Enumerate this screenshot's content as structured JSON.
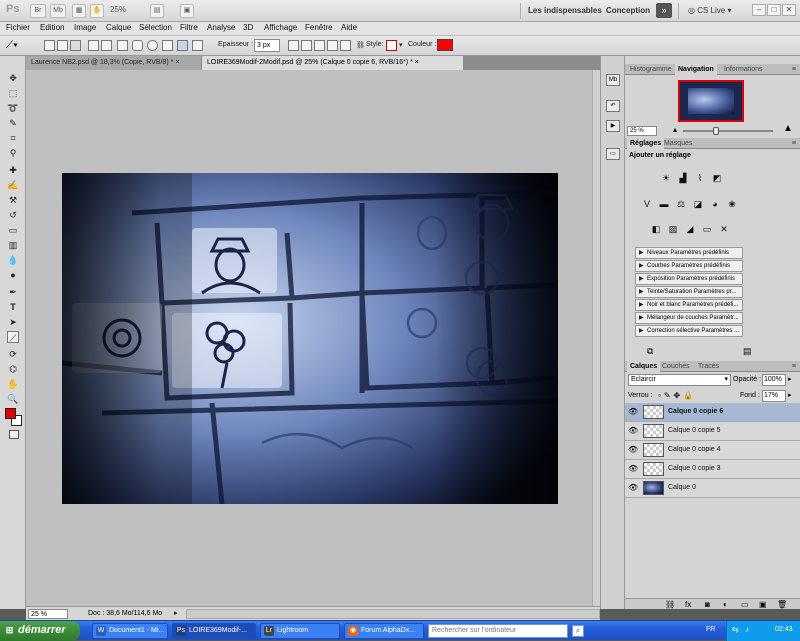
{
  "appbar": {
    "app_icon": "Ps",
    "buttons": [
      "Br",
      "Mb"
    ],
    "zoom": "25%",
    "workspace_primary": "Les indispensables",
    "workspace_secondary": "Conception",
    "expand": "»",
    "cs_live": "CS Live",
    "window_controls": [
      "–",
      "□",
      "✕"
    ]
  },
  "menu": [
    "Fichier",
    "Edition",
    "Image",
    "Calque",
    "Sélection",
    "Filtre",
    "Analyse",
    "3D",
    "Affichage",
    "Fenêtre",
    "Aide"
  ],
  "options": {
    "epaisseur_label": "Epaisseur :",
    "epaisseur_value": "3 px",
    "style_label": "Style:",
    "couleur_label": "Couleur :",
    "color": "#ff0000"
  },
  "doc_tabs": [
    {
      "label": "Laurence NB2.psd @ 18,3% (Copie, RVB/8) *",
      "close": "×"
    },
    {
      "label": "LOIRE369Modif-2Modif.psd @ 25% (Calque 0 copie 6, RVB/16*) *",
      "close": "×"
    }
  ],
  "status": {
    "zoom": "25 %",
    "doc": "Doc : 38,6 Mo/114,6 Mo"
  },
  "panels": {
    "top_tabs": [
      "Histogramme",
      "Navigation",
      "Informations"
    ],
    "nav_zoom": "25 %",
    "adj_tabs": [
      "Réglages",
      "Masques"
    ],
    "adj_title": "Ajouter un réglage",
    "presets": [
      "Niveaux Paramètres prédéfinis",
      "Courbes Paramètres prédéfinis",
      "Exposition Paramètres prédéfinis",
      "Teinte/Saturation Paramètres pr...",
      "Noir et blanc Paramètres prédéfi...",
      "Mélangeur de couches Paramètr...",
      "Correction sélective Paramètres ..."
    ],
    "layer_tabs": [
      "Calques",
      "Couches",
      "Tracés"
    ],
    "blend_mode": "Eclaircir",
    "opacity_label": "Opacité :",
    "opacity_value": "100%",
    "lock_label": "Verrou :",
    "fill_label": "Fond :",
    "fill_value": "17%",
    "layers": [
      {
        "name": "Calque 0 copie 6",
        "selected": true
      },
      {
        "name": "Calque 0 copie 5",
        "selected": false
      },
      {
        "name": "Calque 0 copie 4",
        "selected": false
      },
      {
        "name": "Calque 0 copie 3",
        "selected": false
      },
      {
        "name": "Calque 0",
        "selected": false
      }
    ]
  },
  "taskbar": {
    "start": "démarrer",
    "items": [
      "Document1 - Mi...",
      "LOIRE369Modif-...",
      "Lightroom",
      "Forum AlphaDx..."
    ],
    "search_placeholder": "Rechercher sur l'ordinateur",
    "lang": "FR",
    "clock": "02:43"
  },
  "icons": {
    "toolbox": [
      "move-icon",
      "marquee-icon",
      "lasso-icon",
      "quick-select-icon",
      "crop-icon",
      "eyedropper-icon",
      "healing-icon",
      "brush-icon",
      "clone-stamp-icon",
      "history-brush-icon",
      "eraser-icon",
      "gradient-icon",
      "blur-icon",
      "dodge-icon",
      "pen-icon",
      "type-icon",
      "path-select-icon",
      "line-icon",
      "3d-rotate-icon",
      "3d-camera-icon",
      "hand-icon",
      "zoom-icon"
    ]
  }
}
